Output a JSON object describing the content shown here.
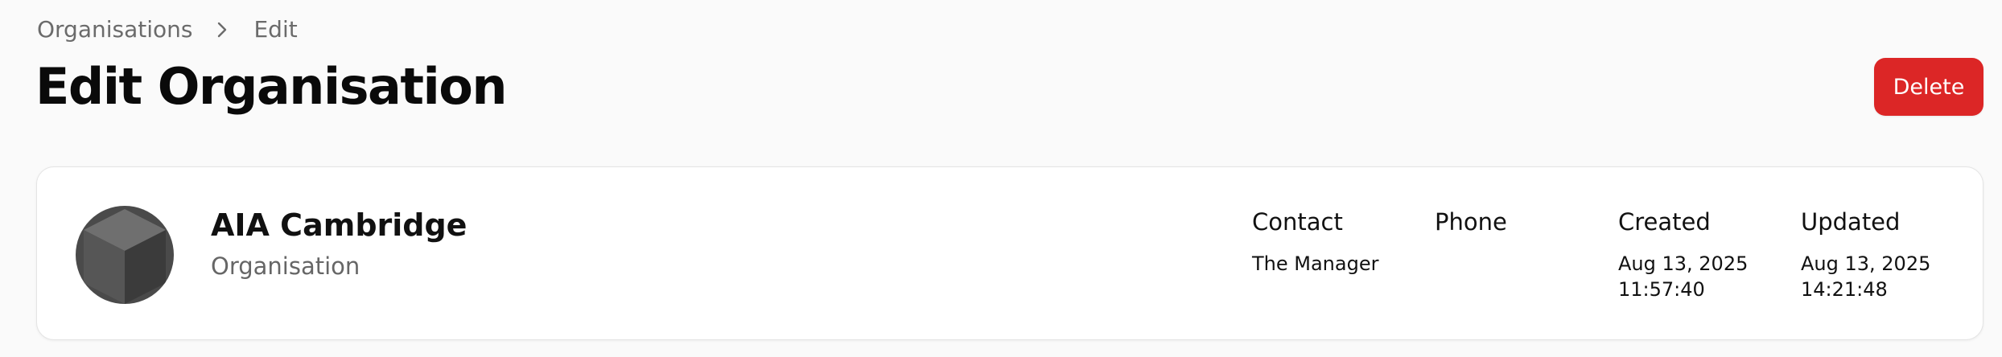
{
  "breadcrumb": {
    "items": [
      {
        "label": "Organisations"
      },
      {
        "label": "Edit"
      }
    ]
  },
  "header": {
    "title": "Edit Organisation",
    "delete_label": "Delete",
    "delete_color": "#dc2626"
  },
  "organisation": {
    "name": "AIA Cambridge",
    "type": "Organisation",
    "avatar_icon": "cube-icon",
    "details": {
      "contact": {
        "label": "Contact",
        "value": "The Manager"
      },
      "phone": {
        "label": "Phone",
        "value": ""
      },
      "created": {
        "label": "Created",
        "date": "Aug 13, 2025",
        "time": "11:57:40"
      },
      "updated": {
        "label": "Updated",
        "date": "Aug 13, 2025",
        "time": "14:21:48"
      }
    }
  }
}
